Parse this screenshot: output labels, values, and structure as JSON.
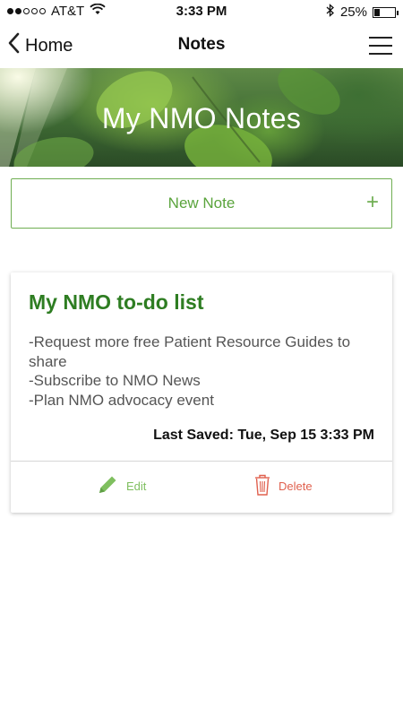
{
  "status_bar": {
    "carrier": "AT&T",
    "time": "3:33 PM",
    "battery": "25%",
    "battery_level": 0.25,
    "signal_bars_filled": 2,
    "signal_bars_total": 5
  },
  "nav": {
    "back_label": "Home",
    "title": "Notes"
  },
  "hero": {
    "title": "My NMO Notes"
  },
  "new_note": {
    "label": "New Note",
    "plus": "+"
  },
  "note": {
    "title": "My NMO to-do list",
    "lines": [
      "-Request more free Patient Resource Guides to share",
      "-Subscribe to NMO News",
      "-Plan NMO advocacy event"
    ],
    "last_saved": "Last Saved: Tue, Sep 15 3:33 PM",
    "edit_label": "Edit",
    "delete_label": "Delete"
  },
  "colors": {
    "accent_green": "#5aa43c",
    "title_green": "#2e7d22",
    "delete_red": "#e0604e"
  }
}
